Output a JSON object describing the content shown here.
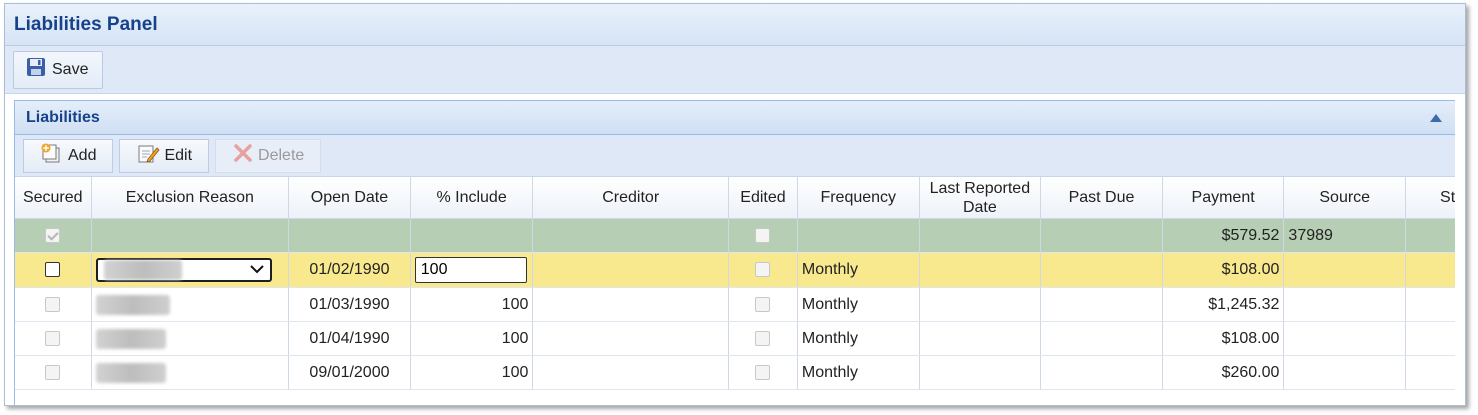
{
  "panel": {
    "title": "Liabilities Panel"
  },
  "toolbar": {
    "save_label": "Save"
  },
  "grid": {
    "title": "Liabilities",
    "buttons": {
      "add": "Add",
      "edit": "Edit",
      "delete": "Delete"
    },
    "columns": [
      "Secured",
      "Exclusion Reason",
      "Open Date",
      "% Include",
      "Creditor",
      "Edited",
      "Frequency",
      "Last Reported Date",
      "Past Due",
      "Payment",
      "Source",
      "Status"
    ],
    "summary": {
      "payment": "$579.52",
      "source": "37989"
    },
    "rows": [
      {
        "open_date": "01/02/1990",
        "include": "100",
        "frequency": "Monthly",
        "payment": "$108.00"
      },
      {
        "open_date": "01/03/1990",
        "include": "100",
        "frequency": "Monthly",
        "payment": "$1,245.32"
      },
      {
        "open_date": "01/04/1990",
        "include": "100",
        "frequency": "Monthly",
        "payment": "$108.00"
      },
      {
        "open_date": "09/01/2000",
        "include": "100",
        "frequency": "Monthly",
        "payment": "$260.00"
      }
    ]
  },
  "colors": {
    "accent": "#15428b",
    "selected_row": "#f9e98e",
    "summary_row": "#b6cfb4"
  }
}
